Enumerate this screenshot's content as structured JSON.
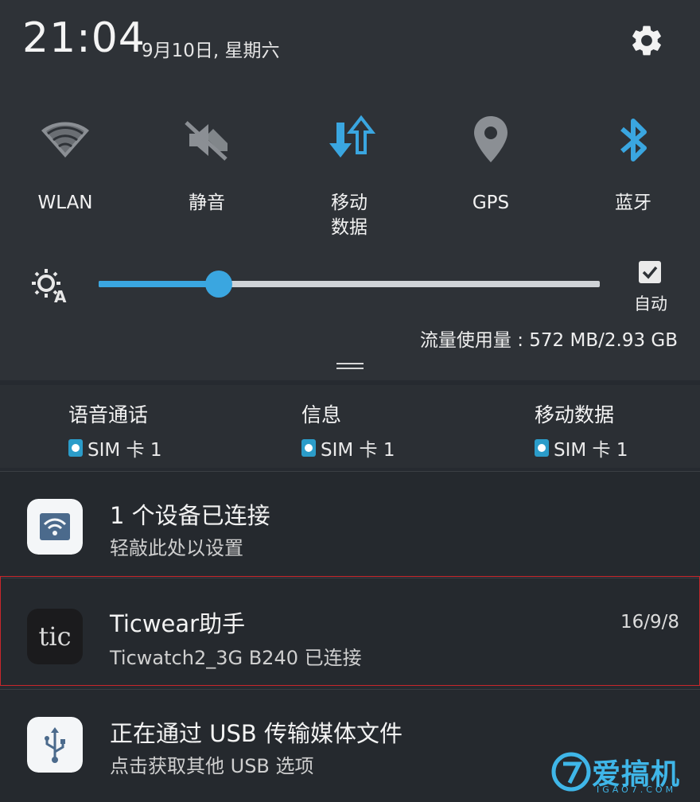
{
  "header": {
    "time": "21:04",
    "date": "9月10日, 星期六",
    "settings_icon": "gear-icon"
  },
  "quick_settings": [
    {
      "label": "WLAN",
      "icon": "wifi-icon",
      "active": false
    },
    {
      "label": "静音",
      "icon": "mute-icon",
      "active": false
    },
    {
      "label": "移动\n数据",
      "icon": "mobile-data-icon",
      "active": true
    },
    {
      "label": "GPS",
      "icon": "location-icon",
      "active": false
    },
    {
      "label": "蓝牙",
      "icon": "bluetooth-icon",
      "active": true
    }
  ],
  "brightness": {
    "level": 0.24,
    "auto_label": "自动",
    "auto_checked": true
  },
  "data_usage": "流量使用量 : 572 MB/2.93 GB",
  "sim_settings": [
    {
      "title": "语音通话",
      "sim": "SIM 卡 1"
    },
    {
      "title": "信息",
      "sim": "SIM 卡 1"
    },
    {
      "title": "移动数据",
      "sim": "SIM 卡 1"
    }
  ],
  "notifications": [
    {
      "title": "1 个设备已连接",
      "text": "轻敲此处以设置",
      "time": "",
      "icon": "hotspot-icon"
    },
    {
      "title": "Ticwear助手",
      "text": "Ticwatch2_3G B240 已连接",
      "time": "16/9/8",
      "icon": "ticwear-app-icon",
      "icon_text": "tic"
    },
    {
      "title": "正在通过 USB 传输媒体文件",
      "text": "点击获取其他 USB 选项",
      "time": "",
      "icon": "usb-icon"
    }
  ],
  "watermark": {
    "text": "爱搞机",
    "sub": "IGAO7.COM"
  },
  "colors": {
    "accent": "#3aa6e0",
    "inactive_icon": "#8b8f94",
    "highlight_border": "#c8262b"
  }
}
